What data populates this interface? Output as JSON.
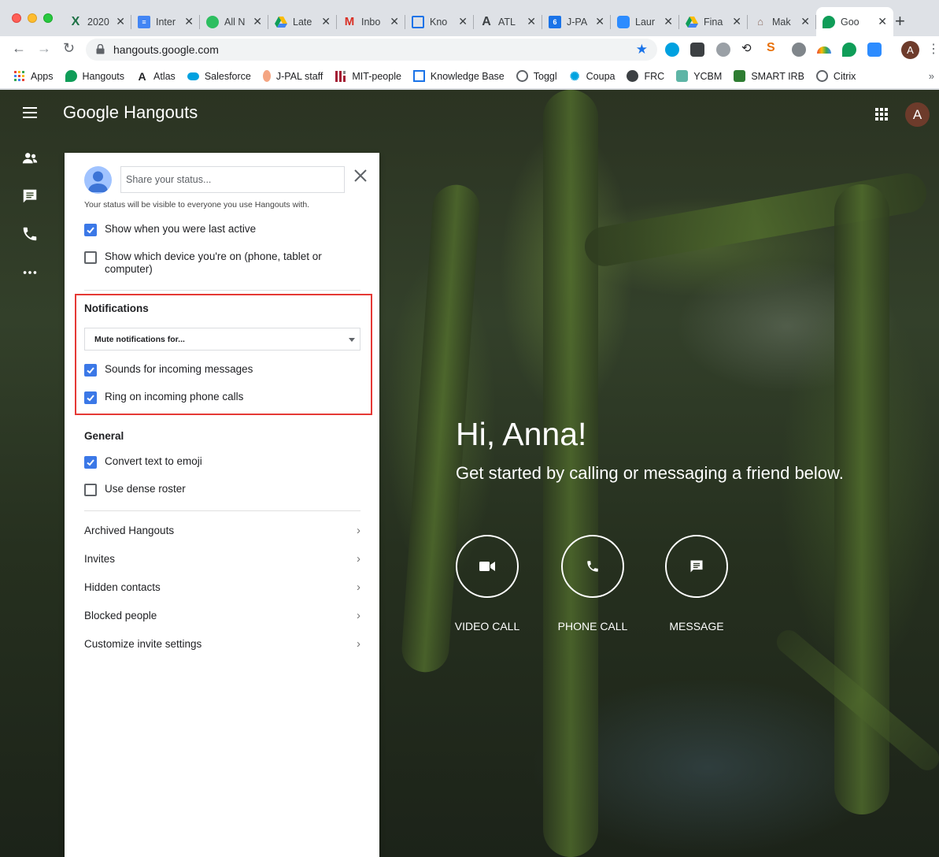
{
  "browser": {
    "tabs": [
      {
        "title": "2020 ",
        "icon": "excel-icon",
        "color": "#1e7145"
      },
      {
        "title": "Inter",
        "icon": "docs-icon",
        "color": "#4285f4"
      },
      {
        "title": "All N",
        "icon": "evernote-icon",
        "color": "#2dbe60"
      },
      {
        "title": "Late",
        "icon": "drive-icon",
        "color": "#fbbc04"
      },
      {
        "title": "Inbo",
        "icon": "gmail-icon",
        "color": "#d93025"
      },
      {
        "title": "Kno",
        "icon": "knowledge-base-icon",
        "color": "#1a73e8"
      },
      {
        "title": "ATL",
        "icon": "atlas-icon",
        "color": "#202124"
      },
      {
        "title": "J-PA",
        "icon": "calendar-icon",
        "color": "#1a73e8"
      },
      {
        "title": "Laur",
        "icon": "zoom-icon",
        "color": "#2d8cff"
      },
      {
        "title": "Fina",
        "icon": "drive-icon",
        "color": "#fbbc04"
      },
      {
        "title": "Mak",
        "icon": "building-icon",
        "color": "#8d6e63"
      },
      {
        "title": "Goo",
        "icon": "hangouts-icon",
        "color": "#0f9d58"
      }
    ],
    "url": "hangouts.google.com",
    "profile_initial": "A"
  },
  "bookmarks": [
    {
      "label": "Apps",
      "icon": "apps-grid-icon",
      "color": "#ea4335"
    },
    {
      "label": "Hangouts",
      "icon": "hangouts-icon",
      "color": "#0f9d58"
    },
    {
      "label": "Atlas",
      "icon": "atlas-icon",
      "color": "#202124"
    },
    {
      "label": "Salesforce",
      "icon": "salesforce-icon",
      "color": "#00a1e0"
    },
    {
      "label": "J-PAL staff",
      "icon": "jpal-icon",
      "color": "#f4a582"
    },
    {
      "label": "MIT-people",
      "icon": "mit-icon",
      "color": "#a31f34"
    },
    {
      "label": "Knowledge Base",
      "icon": "knowledge-base-icon",
      "color": "#1a73e8"
    },
    {
      "label": "Toggl",
      "icon": "toggl-icon",
      "color": "#5f6368"
    },
    {
      "label": "Coupa",
      "icon": "coupa-icon",
      "color": "#00a3e0"
    },
    {
      "label": "FRC",
      "icon": "globe-icon",
      "color": "#3c4043"
    },
    {
      "label": "YCBM",
      "icon": "ycbm-icon",
      "color": "#5eb5a6"
    },
    {
      "label": "SMART IRB",
      "icon": "smart-irb-icon",
      "color": "#2e7d32"
    },
    {
      "label": "Citrix",
      "icon": "citrix-icon",
      "color": "#5f6368"
    }
  ],
  "app": {
    "logo_prefix": "Google",
    "logo_suffix": " Hangouts",
    "avatar_initial": "A"
  },
  "settings": {
    "status_placeholder": "Share your status...",
    "status_hint": "Your status will be visible to everyone you use Hangouts with.",
    "privacy": [
      {
        "label": "Show when you were last active",
        "checked": true
      },
      {
        "label": "Show which device you're on (phone, tablet or computer)",
        "checked": false
      }
    ],
    "notifications_title": "Notifications",
    "mute_label": "Mute notifications for...",
    "notifications": [
      {
        "label": "Sounds for incoming messages",
        "checked": true
      },
      {
        "label": "Ring on incoming phone calls",
        "checked": true
      }
    ],
    "general_title": "General",
    "general": [
      {
        "label": "Convert text to emoji",
        "checked": true
      },
      {
        "label": "Use dense roster",
        "checked": false
      }
    ],
    "links": [
      "Archived Hangouts",
      "Invites",
      "Hidden contacts",
      "Blocked people",
      "Customize invite settings"
    ]
  },
  "welcome": {
    "greeting": "Hi, Anna!",
    "subtitle": "Get started by calling or messaging a friend below.",
    "actions": [
      "VIDEO CALL",
      "PHONE CALL",
      "MESSAGE"
    ]
  },
  "colors": {
    "accent": "#3b78e7",
    "highlight_border": "#e53935"
  }
}
